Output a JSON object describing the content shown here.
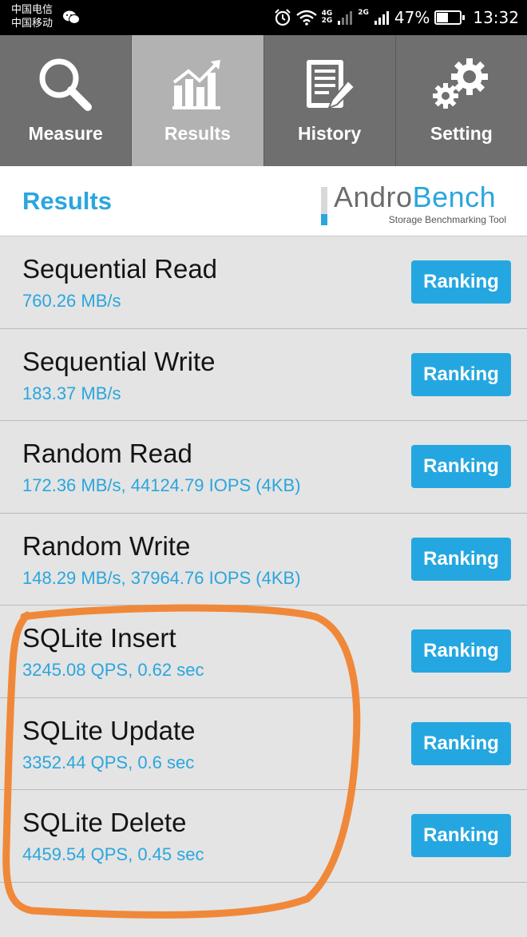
{
  "status_bar": {
    "carrier_1": "中国电信",
    "carrier_2": "中国移动",
    "network_1": "4G",
    "network_1b": "2G",
    "network_2": "2G",
    "battery_percent": "47%",
    "battery_level": 0.47,
    "time": "13:32"
  },
  "tabs": [
    {
      "label": "Measure",
      "icon": "search-icon",
      "active": false
    },
    {
      "label": "Results",
      "icon": "chart-icon",
      "active": true
    },
    {
      "label": "History",
      "icon": "document-edit-icon",
      "active": false
    },
    {
      "label": "Setting",
      "icon": "gear-icon",
      "active": false
    }
  ],
  "header": {
    "title": "Results",
    "logo_andro": "Andro",
    "logo_bench": "Bench",
    "logo_tagline": "Storage Benchmarking Tool"
  },
  "results": [
    {
      "name": "Sequential Read",
      "value": "760.26 MB/s",
      "button": "Ranking"
    },
    {
      "name": "Sequential Write",
      "value": "183.37 MB/s",
      "button": "Ranking"
    },
    {
      "name": "Random Read",
      "value": "172.36 MB/s, 44124.79 IOPS (4KB)",
      "button": "Ranking"
    },
    {
      "name": "Random Write",
      "value": "148.29 MB/s, 37964.76 IOPS (4KB)",
      "button": "Ranking"
    },
    {
      "name": "SQLite Insert",
      "value": "3245.08 QPS, 0.62 sec",
      "button": "Ranking"
    },
    {
      "name": "SQLite Update",
      "value": "3352.44 QPS, 0.6 sec",
      "button": "Ranking"
    },
    {
      "name": "SQLite Delete",
      "value": "4459.54 QPS, 0.45 sec",
      "button": "Ranking"
    }
  ],
  "colors": {
    "accent": "#2aa6de",
    "button": "#24a7e0",
    "tab_bg": "#6f6f6f",
    "tab_active_bg": "#b2b2b2",
    "annotation": "#f0883a"
  }
}
